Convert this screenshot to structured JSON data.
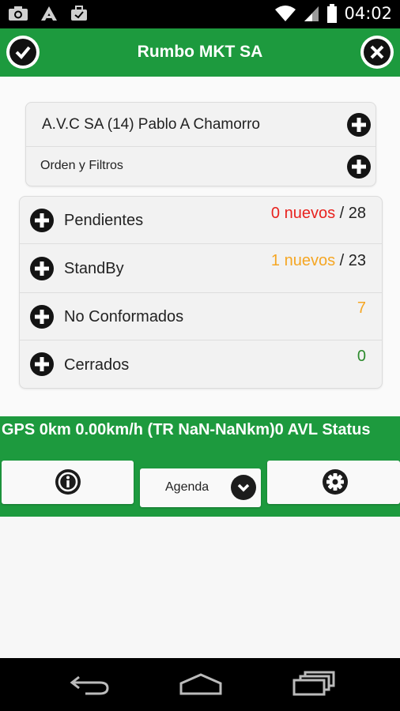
{
  "statusbar": {
    "time": "04:02",
    "icons": [
      "camera-icon",
      "triangle-app-icon",
      "briefcase-icon",
      "wifi-icon",
      "signal-icon",
      "battery-icon"
    ]
  },
  "header": {
    "title": "Rumbo MKT SA",
    "left_icon": "check-icon",
    "right_icon": "close-icon"
  },
  "client_card": {
    "client": "A.V.C SA (14) Pablo A Chamorro",
    "filters": "Orden y Filtros"
  },
  "status_list": [
    {
      "label": "Pendientes",
      "nuevos": "0 nuevos",
      "total": "/ 28",
      "nuevos_color": "#e8231f"
    },
    {
      "label": "StandBy",
      "nuevos": "1 nuevos",
      "total": "/ 23",
      "nuevos_color": "#f5a623"
    },
    {
      "label": "No Conformados",
      "count": "7",
      "count_color": "#f5a623"
    },
    {
      "label": "Cerrados",
      "count": "0",
      "count_color": "#2e8b2e"
    }
  ],
  "gps": {
    "text": "GPS 0km 0.00km/h (TR NaN-NaNkm)0 AVL Status"
  },
  "toolbar": {
    "info_icon": "info-icon",
    "agenda_label": "Agenda",
    "settings_icon": "gear-icon"
  },
  "colors": {
    "brand_green": "#1d9a3e"
  }
}
